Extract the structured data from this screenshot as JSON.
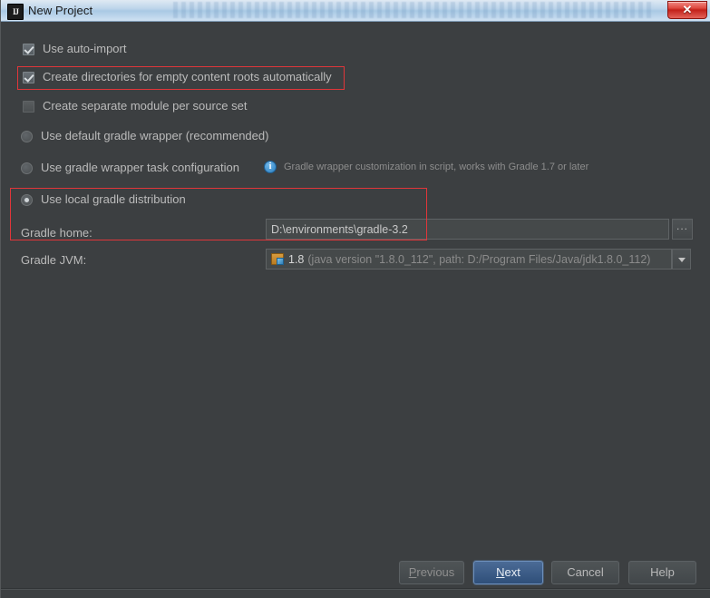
{
  "titlebar": {
    "title": "New Project",
    "app_icon": "intellij-idea-icon",
    "close_label": "✕"
  },
  "options": {
    "use_auto_import": {
      "label": "Use auto-import",
      "checked": true
    },
    "create_directories": {
      "label": "Create directories for empty content roots automatically",
      "checked": true,
      "highlighted": true
    },
    "create_separate_module": {
      "label": "Create separate module per source set",
      "checked": false
    }
  },
  "gradle_source": {
    "default_wrapper": {
      "label": "Use default gradle wrapper (recommended)",
      "selected": false
    },
    "wrapper_task": {
      "label": "Use gradle wrapper task configuration",
      "selected": false
    },
    "wrapper_task_hint": "Gradle wrapper customization in script, works with Gradle 1.7 or later",
    "local_distribution": {
      "label": "Use local gradle distribution",
      "selected": true,
      "highlighted": true
    }
  },
  "gradle_home": {
    "label": "Gradle home:",
    "value": "D:\\environments\\gradle-3.2",
    "placeholder": "",
    "browse_label": "..."
  },
  "gradle_jvm": {
    "label": "Gradle JVM:",
    "version": "1.8",
    "details": "(java version \"1.8.0_112\", path: D:/Program Files/Java/jdk1.8.0_112)"
  },
  "footer": {
    "previous": "Previous",
    "previous_mnemonic": "P",
    "next_mnemonic": "N",
    "next_rest": "ext",
    "cancel": "Cancel",
    "help": "Help"
  },
  "colors": {
    "background": "#3c3f41",
    "accent_blue": "#2f4f79",
    "annotation_red": "#e0363a",
    "text_primary": "#bbbbbb",
    "text_dim": "#8b8b8b"
  }
}
